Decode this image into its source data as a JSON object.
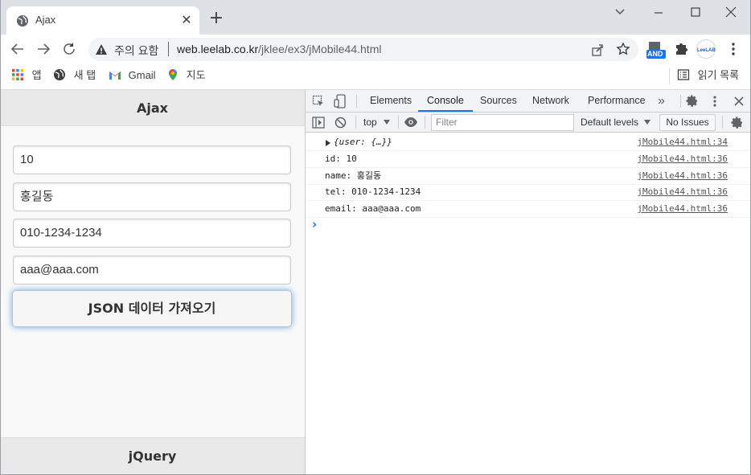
{
  "browser": {
    "tab_title": "Ajax",
    "new_tab": "+",
    "tab_close": "✕"
  },
  "toolbar": {
    "security_label": "주의 요함",
    "url_host": "web.leelab.co.kr",
    "url_path": "/jklee/ex3/jMobile44.html",
    "ext_and_label": "AND",
    "ext_leelab_label": "LeeLAB"
  },
  "bookmarks": {
    "apps": "앱",
    "new_tab": "새 탭",
    "gmail": "Gmail",
    "maps": "지도",
    "reading_list": "읽기 목록"
  },
  "page": {
    "header": "Ajax",
    "fields": [
      "10",
      "홍길동",
      "010-1234-1234",
      "aaa@aaa.com"
    ],
    "button": "JSON 데이터 가져오기",
    "footer": "jQuery"
  },
  "devtools": {
    "tabs": [
      "Elements",
      "Console",
      "Sources",
      "Network",
      "Performance"
    ],
    "more_tabs": "»",
    "context": "top",
    "filter_placeholder": "Filter",
    "levels": "Default levels",
    "issues": "No Issues",
    "logs": [
      {
        "msg": "{user: {…}}",
        "src": "jMobile44.html:34",
        "italic": true
      },
      {
        "msg": "id: 10",
        "src": "jMobile44.html:36"
      },
      {
        "msg": "name: 홍길동",
        "src": "jMobile44.html:36"
      },
      {
        "msg": "tel: 010-1234-1234",
        "src": "jMobile44.html:36"
      },
      {
        "msg": "email: aaa@aaa.com",
        "src": "jMobile44.html:36"
      }
    ],
    "prompt": "›"
  }
}
